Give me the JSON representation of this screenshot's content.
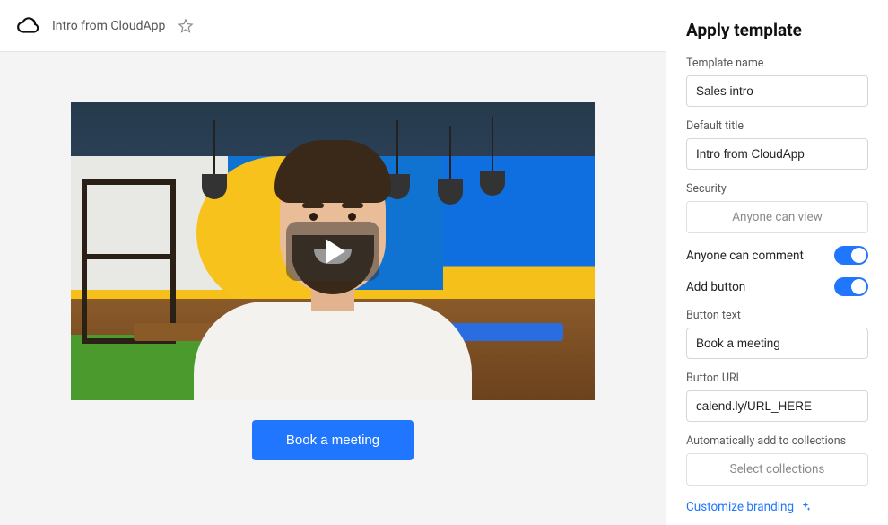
{
  "header": {
    "title": "Intro from CloudApp"
  },
  "preview": {
    "cta_label": "Book a meeting"
  },
  "sidebar": {
    "heading": "Apply template",
    "template_name": {
      "label": "Template name",
      "value": "Sales intro"
    },
    "default_title": {
      "label": "Default title",
      "value": "Intro from CloudApp"
    },
    "security": {
      "label": "Security",
      "value": "Anyone can view"
    },
    "comment_toggle": {
      "label": "Anyone can comment",
      "on": true
    },
    "add_button_toggle": {
      "label": "Add button",
      "on": true
    },
    "button_text": {
      "label": "Button text",
      "value": "Book a meeting"
    },
    "button_url": {
      "label": "Button URL",
      "value": "calend.ly/URL_HERE"
    },
    "collections": {
      "label": "Automatically add to collections",
      "value": "Select collections"
    },
    "customize_link": "Customize branding"
  }
}
